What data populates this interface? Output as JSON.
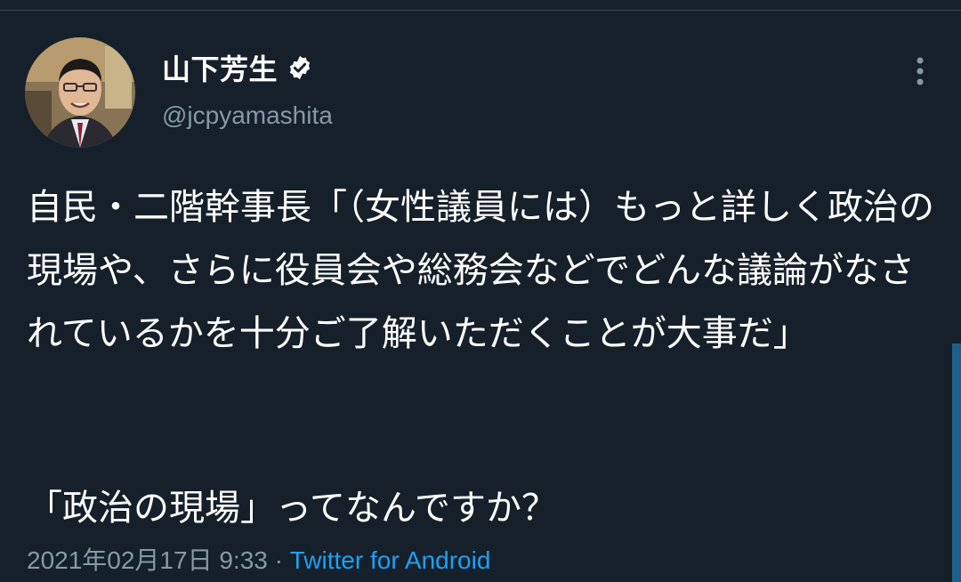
{
  "author": {
    "display_name": "山下芳生",
    "handle": "@jcpyamashita",
    "verified": true
  },
  "tweet": {
    "body": "自民・二階幹事長「（女性議員には）もっと詳しく政治の現場や、さらに役員会や総務会などでどんな議論がなされているかを十分ご了解いただくことが大事だ」",
    "body_2": "「政治の現場」ってなんですか？"
  },
  "meta": {
    "timestamp": "2021年02月17日 9:33",
    "separator": " · ",
    "source": "Twitter for Android"
  },
  "icons": {
    "more": "more-vertical-icon",
    "verified": "verified-badge-icon"
  },
  "colors": {
    "background": "#15202b",
    "text": "#ffffff",
    "secondary": "#8899a6",
    "link": "#1da1f2"
  }
}
